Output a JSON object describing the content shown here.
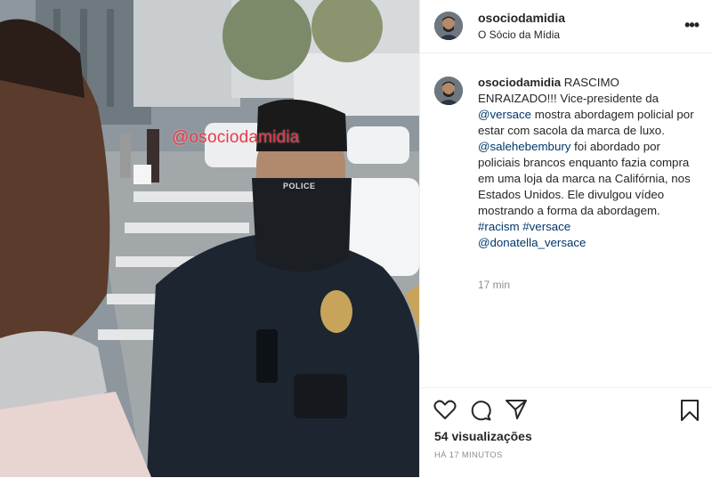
{
  "video": {
    "watermark": "@osociodamidia",
    "badge": "POLICE"
  },
  "header": {
    "username": "osociodamidia",
    "subtitle": "O Sócio da Mídia",
    "more_icon": "more-horizontal-icon"
  },
  "caption": {
    "username": "osociodamidia",
    "text_1": " RASCIMO ENRAIZADO!!! Vice-presidente da ",
    "mention_1": "@versace",
    "text_2": " mostra abordagem policial por estar com sacola da marca de luxo.",
    "mention_2": "@salehebembury",
    "text_3": " foi abordado por policiais brancos enquanto fazia compra em uma loja da marca na Califórnia, nos Estados Unidos. Ele divulgou vídeo mostrando a forma da abordagem. ",
    "hashtag_1": "#racism",
    "hashtag_2": "#versace",
    "mention_3": "@donatella_versace",
    "time": "17 min"
  },
  "actions": {
    "icons": [
      "heart-icon",
      "comment-icon",
      "share-icon",
      "bookmark-icon"
    ],
    "views_count": "54",
    "views_label": " visualizações",
    "ago": "HÁ 17 MINUTOS"
  },
  "colors": {
    "link": "#00376b",
    "text": "#262626",
    "muted": "#8e8e8e",
    "watermark": "#e8384a"
  }
}
